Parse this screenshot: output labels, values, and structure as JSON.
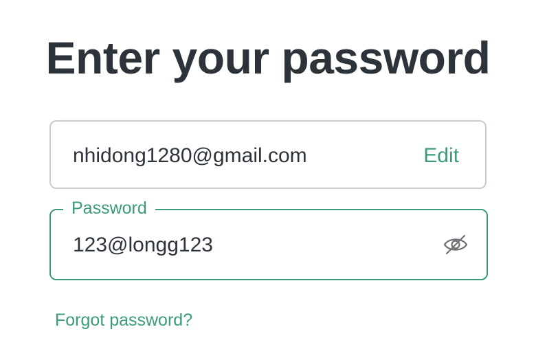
{
  "header": {
    "title": "Enter your password"
  },
  "email": {
    "value": "nhidong1280@gmail.com",
    "edit_label": "Edit"
  },
  "password": {
    "label": "Password",
    "value": "123@longg123",
    "toggle_icon": "eye-slash-icon"
  },
  "links": {
    "forgot_password": "Forgot password?"
  },
  "colors": {
    "accent": "#3b9b7b",
    "text": "#2d333a",
    "border": "#c9cbce",
    "icon": "#6e7075"
  }
}
